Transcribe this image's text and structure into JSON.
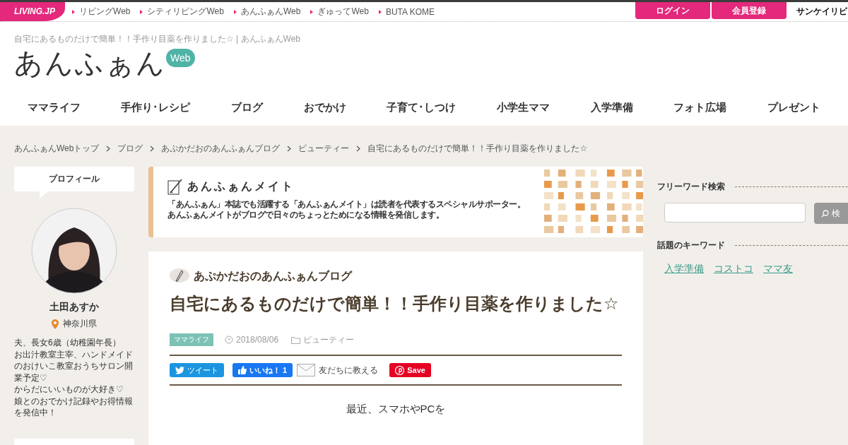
{
  "top_bar": {
    "logo": "LIVING.JP",
    "links": [
      "リビングWeb",
      "シティリビングWeb",
      "あんふぁんWeb",
      "ぎゅってWeb",
      "BUTA KOME"
    ],
    "buttons": [
      "ログイン",
      "会員登録"
    ],
    "partner": "サンケイリビ"
  },
  "header": {
    "page_title": "自宅にあるものだけで簡単！！手作り目薬を作りました☆ | あんふぁんWeb",
    "logo": "あんふぁん",
    "logo_badge": "Web"
  },
  "nav": [
    "ママライフ",
    "手作り･レシピ",
    "ブログ",
    "おでかけ",
    "子育て･しつけ",
    "小学生ママ",
    "入学準備",
    "フォト広場",
    "プレゼント"
  ],
  "breadcrumb": [
    "あんふぁんWebトップ",
    "ブログ",
    "あぷかだおのあんふぁんブログ",
    "ビューティー",
    "自宅にあるものだけで簡単！！手作り目薬を作りました☆"
  ],
  "profile": {
    "heading": "プロフィール",
    "name": "土田あすか",
    "location": "神奈川県",
    "bio": [
      "夫、長女6歳（幼稚園年長）",
      "お出汁教室主宰、ハンドメイドのおけいこ教室おうちサロン開業予定♡",
      "からだにいいものが大好き♡",
      "娘とのおでかけ記録やお得情報を発信中！"
    ]
  },
  "mate_banner": {
    "title": "あんふぁんメイト",
    "description": [
      "「あんふぁん」本誌でも活躍する「あんふぁんメイト」は読者を代表するスペシャルサポーター。",
      "あんふぁんメイトがブログで日々のちょっとためになる情報を発信します。"
    ]
  },
  "article": {
    "blog_name": "あぷかだおのあんふぁんブログ",
    "title": "自宅にあるものだけで簡単！！手作り目薬を作りました☆",
    "tag": "ママライフ",
    "date": "2018/08/06",
    "category": "ビューティー",
    "share": [
      {
        "kind": "tweet",
        "label": "ツイート"
      },
      {
        "kind": "like",
        "label": "いいね！",
        "count": "1"
      },
      {
        "kind": "mail",
        "label": "友だちに教える"
      },
      {
        "kind": "pin",
        "label": "Save"
      }
    ],
    "body": [
      "最近、スマホやPCを"
    ]
  },
  "sidebar": {
    "search": {
      "heading": "フリーワード検索",
      "button": "検"
    },
    "keywords": {
      "heading": "話題のキーワード",
      "items": [
        "入学準備",
        "コストコ",
        "ママ友"
      ]
    }
  }
}
